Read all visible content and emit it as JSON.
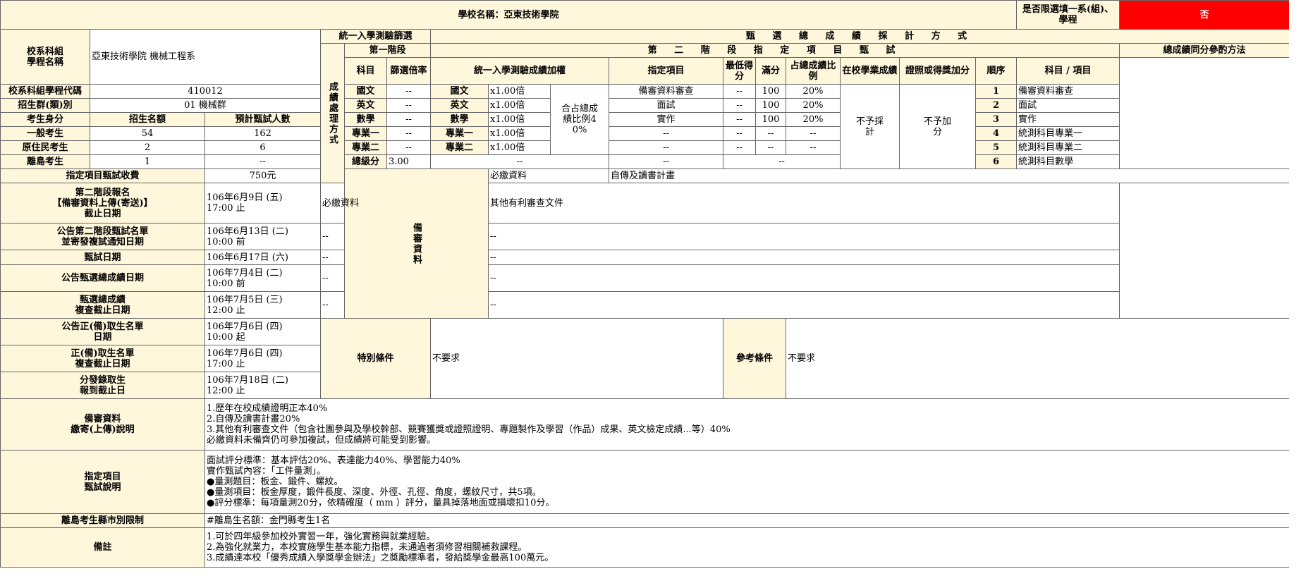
{
  "header": {
    "school_label": "學校名稱：亞東技術學院",
    "limit_question": "是否限選填一系(組)、學程",
    "limit_answer": "否"
  },
  "dept": {
    "name_label": "校系科組\n學程名稱",
    "name_value": "亞東技術學院 機械工程系",
    "code_label": "校系科組學程代碼",
    "code_value": "410012",
    "group_label": "招生群(類)別",
    "group_value": "01 機械群"
  },
  "quota": {
    "col_identity": "考生身分",
    "col_quota": "招生名額",
    "col_expected": "預計甄試人數",
    "rows": [
      {
        "identity": "一般考生",
        "quota": "54",
        "expected": "162"
      },
      {
        "identity": "原住民考生",
        "quota": "2",
        "expected": "6"
      },
      {
        "identity": "離島考生",
        "quota": "1",
        "expected": "--"
      }
    ]
  },
  "method": {
    "side_label": "成績處理方式",
    "unified_header": "統一入學測驗篩選",
    "selection_header": "甄 選 總 成 績 採 計 方 式",
    "stage1_header": "第一階段",
    "stage2_header": "第 二 階 段 指 定 項 目 甄 試",
    "tie_header": "總成績同分參酌方法",
    "col_subject": "科目",
    "col_multiplier": "篩選倍率",
    "col_weighting": "統一入學測驗成績加權",
    "col_item": "指定項目",
    "col_min": "最低得分",
    "col_full": "滿分",
    "col_ratio": "占總成績比例",
    "col_school": "在校學業成績",
    "col_cert": "證照或得獎加分",
    "col_order": "順序",
    "col_tie_item": "科目 / 項目",
    "weight_total_ratio": "合占總成績比例40%",
    "school_value": "不予採計",
    "cert_value": "不予加分",
    "total_label": "總級分",
    "total_value": "3.00",
    "total_blank": "--",
    "rows": [
      {
        "subject": "國文",
        "multiplier": "--",
        "w_subject": "國文",
        "w_value": "x1.00倍",
        "item": "備審資料審查",
        "min": "--",
        "full": "100",
        "ratio": "20%",
        "order": "1",
        "tie_item": "備審資料審查"
      },
      {
        "subject": "英文",
        "multiplier": "--",
        "w_subject": "英文",
        "w_value": "x1.00倍",
        "item": "面試",
        "min": "--",
        "full": "100",
        "ratio": "20%",
        "order": "2",
        "tie_item": "面試"
      },
      {
        "subject": "數學",
        "multiplier": "--",
        "w_subject": "數學",
        "w_value": "x1.00倍",
        "item": "實作",
        "min": "--",
        "full": "100",
        "ratio": "20%",
        "order": "3",
        "tie_item": "實作"
      },
      {
        "subject": "專業一",
        "multiplier": "--",
        "w_subject": "專業一",
        "w_value": "x1.00倍",
        "item": "--",
        "min": "--",
        "full": "--",
        "ratio": "--",
        "order": "4",
        "tie_item": "統測科目專業一"
      },
      {
        "subject": "專業二",
        "multiplier": "--",
        "w_subject": "專業二",
        "w_value": "x1.00倍",
        "item": "--",
        "min": "--",
        "full": "--",
        "ratio": "--",
        "order": "5",
        "tie_item": "統測科目專業二"
      }
    ],
    "total_row": {
      "item": "--",
      "rest": "--",
      "order": "6",
      "tie_item": "統測科目數學"
    }
  },
  "schedule": [
    {
      "label": "指定項目甄試收費",
      "value": "750元"
    },
    {
      "label": "第二階段報名\n【備審資料上傳(寄送)】\n截止日期",
      "value": "106年6月9日 (五)\n17:00 止"
    },
    {
      "label": "公告第二階段甄試名單\n並寄發複試通知日期",
      "value": "106年6月13日 (二)\n10:00 前"
    },
    {
      "label": "甄試日期",
      "value": "106年6月17日 (六)"
    },
    {
      "label": "公告甄選總成績日期",
      "value": "106年7月4日 (二)\n10:00 前"
    },
    {
      "label": "甄選總成績\n複查截止日期",
      "value": "106年7月5日 (三)\n12:00 止"
    },
    {
      "label": "公告正(備)取生名單\n日期",
      "value": "106年7月6日 (四)\n10:00 起"
    },
    {
      "label": "正(備)取生名單\n複查截止日期",
      "value": "106年7月6日 (四)\n17:00 止"
    },
    {
      "label": "分發錄取生\n報到截止日",
      "value": "106年7月18日 (二)\n12:00 止"
    }
  ],
  "review": {
    "side_label": "備審資料",
    "rows": [
      {
        "type": "必繳資料",
        "content": "自傳及讀書計畫"
      },
      {
        "type": "必繳資料",
        "content": "其他有利審查文件"
      },
      {
        "type": "--",
        "content": "--"
      },
      {
        "type": "--",
        "content": "--"
      },
      {
        "type": "--",
        "content": "--"
      },
      {
        "type": "--",
        "content": "--"
      }
    ]
  },
  "conditions": {
    "special_label": "特別條件",
    "special_value": "不要求",
    "ref_label": "參考條件",
    "ref_value": "不要求"
  },
  "notes": {
    "review_label": "備審資料\n繳寄(上傳)說明",
    "review_text": "1.歷年在校成績證明正本40%\n2.自傳及讀書計畫20%\n3.其他有利審查文件（包含社團參與及學校幹部、競賽獲獎或證照證明、專題製作及學習（作品）成果、英文檢定成績...等）40%\n必繳資料未備齊仍可參加複試，但成績將可能受到影響。",
    "exam_label": "指定項目\n甄試說明",
    "exam_text": "面試評分標準：基本評估20%、表達能力40%、學習能力40%\n實作甄試內容：「工件量測」。\n●量測題目：板金、鍛件、螺紋。\n●量測項目：板金厚度，鍛件長度、深度、外徑、孔徑、角度，螺紋尺寸，共5項。\n●評分標準：每項量測20分，依精確度（ mm ）評分，量具掉落地面或損壞扣10分。",
    "island_label": "離島考生縣市別限制",
    "island_text": "#離島生名額：金門縣考生1名",
    "remark_label": "備註",
    "remark_text": "1.可於四年級參加校外實習一年，強化實務與就業經驗。\n2.為強化就業力，本校實施學生基本能力指標，未通過者須修習相關補救課程。\n3.成績達本校「優秀成績入學獎學金辦法」之獎勵標準者，發給獎學金最高100萬元。"
  }
}
